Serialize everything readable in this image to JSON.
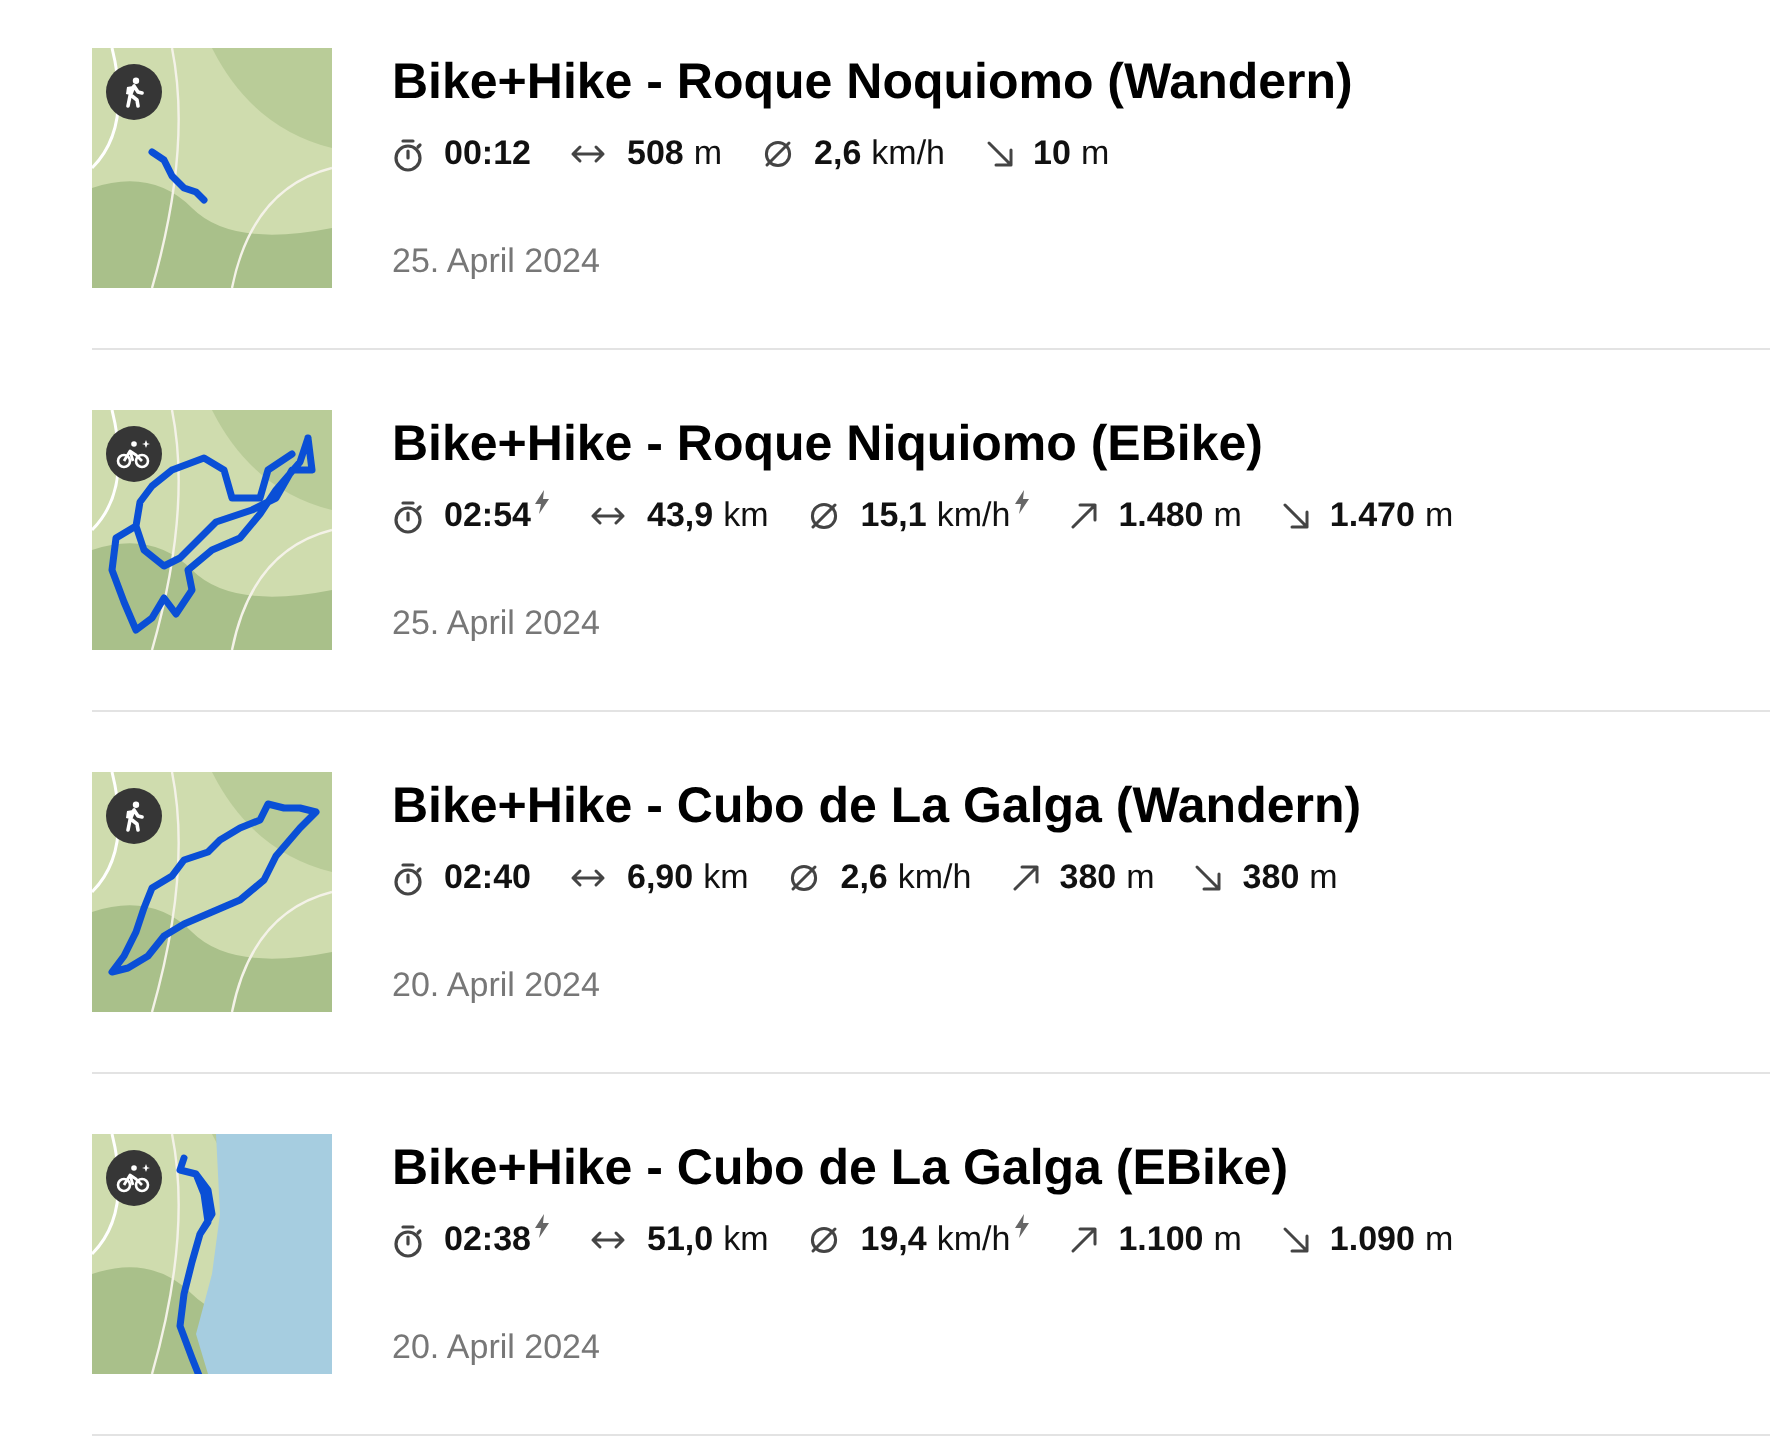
{
  "activities": [
    {
      "kind": "hiking",
      "title": "Bike+Hike - Roque Noquiomo (Wandern)",
      "stats": [
        {
          "kind": "duration",
          "value": "00:12",
          "electric": false
        },
        {
          "kind": "distance",
          "value": "508",
          "unit": "m",
          "electric": false
        },
        {
          "kind": "speed",
          "value": "2,6",
          "unit": "km/h",
          "electric": false
        },
        {
          "kind": "descent",
          "value": "10",
          "unit": "m",
          "electric": false
        }
      ],
      "date": "25. April 2024"
    },
    {
      "kind": "ebike",
      "title": "Bike+Hike - Roque Niquiomo (EBike)",
      "stats": [
        {
          "kind": "duration",
          "value": "02:54",
          "electric": true
        },
        {
          "kind": "distance",
          "value": "43,9",
          "unit": "km",
          "electric": false
        },
        {
          "kind": "speed",
          "value": "15,1",
          "unit": "km/h",
          "electric": true
        },
        {
          "kind": "ascent",
          "value": "1.480",
          "unit": "m",
          "electric": false
        },
        {
          "kind": "descent",
          "value": "1.470",
          "unit": "m",
          "electric": false
        }
      ],
      "date": "25. April 2024"
    },
    {
      "kind": "hiking",
      "title": "Bike+Hike - Cubo de La Galga (Wandern)",
      "stats": [
        {
          "kind": "duration",
          "value": "02:40",
          "electric": false
        },
        {
          "kind": "distance",
          "value": "6,90",
          "unit": "km",
          "electric": false
        },
        {
          "kind": "speed",
          "value": "2,6",
          "unit": "km/h",
          "electric": false
        },
        {
          "kind": "ascent",
          "value": "380",
          "unit": "m",
          "electric": false
        },
        {
          "kind": "descent",
          "value": "380",
          "unit": "m",
          "electric": false
        }
      ],
      "date": "20. April 2024"
    },
    {
      "kind": "ebike",
      "title": "Bike+Hike - Cubo de La Galga (EBike)",
      "stats": [
        {
          "kind": "duration",
          "value": "02:38",
          "electric": true
        },
        {
          "kind": "distance",
          "value": "51,0",
          "unit": "km",
          "electric": false
        },
        {
          "kind": "speed",
          "value": "19,4",
          "unit": "km/h",
          "electric": true
        },
        {
          "kind": "ascent",
          "value": "1.100",
          "unit": "m",
          "electric": false
        },
        {
          "kind": "descent",
          "value": "1.090",
          "unit": "m",
          "electric": false
        }
      ],
      "date": "20. April 2024"
    }
  ]
}
